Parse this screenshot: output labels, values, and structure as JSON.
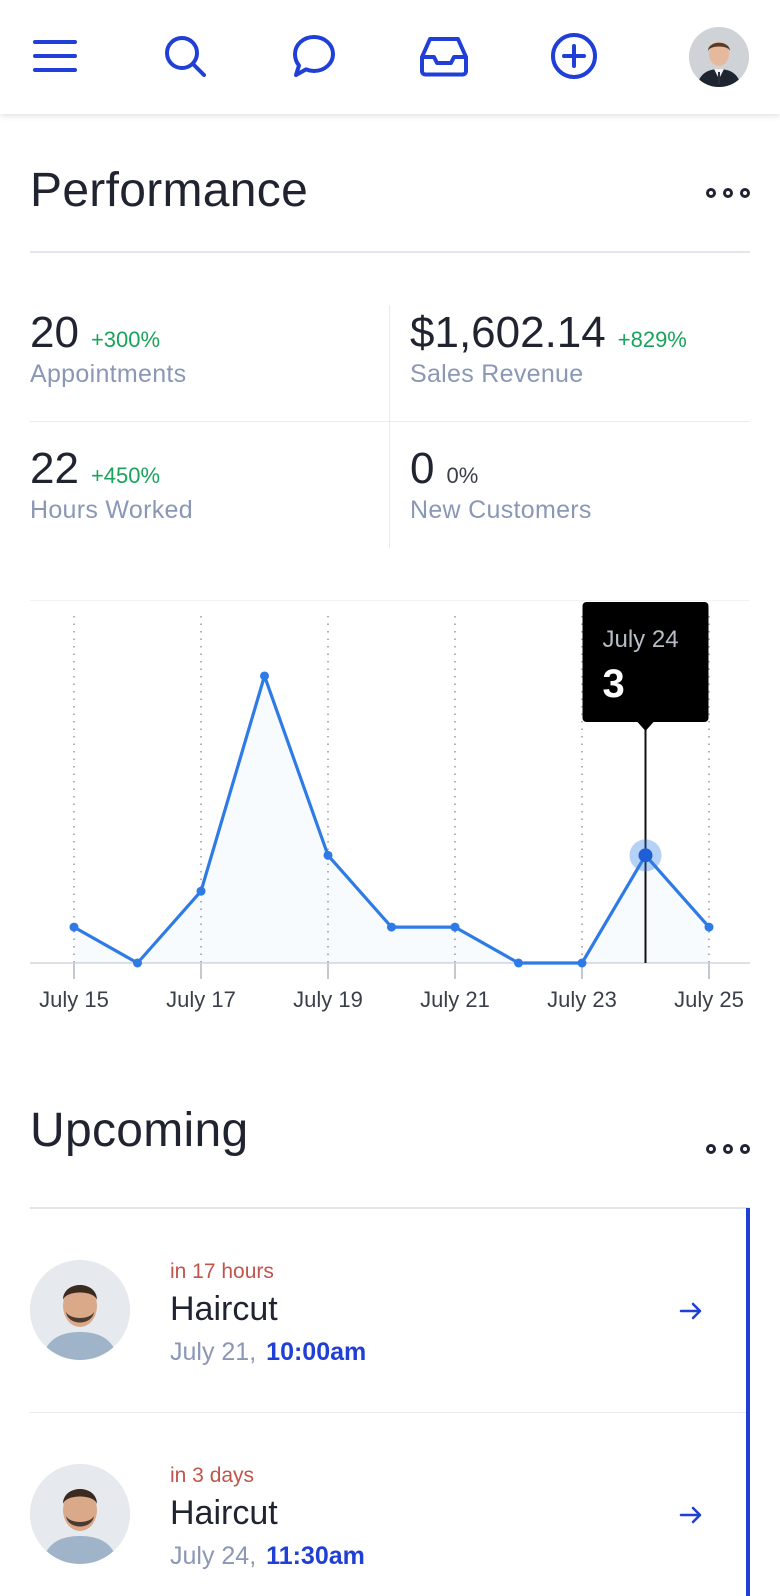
{
  "header": {
    "icons": [
      "menu-icon",
      "search-icon",
      "chat-icon",
      "inbox-icon",
      "add-circle-icon"
    ],
    "accent_color": "#1f3fd6"
  },
  "performance": {
    "title": "Performance",
    "stats": [
      {
        "value": "20",
        "change": "+300%",
        "label": "Appointments"
      },
      {
        "value": "$1,602.14",
        "change": "+829%",
        "label": "Sales Revenue"
      },
      {
        "value": "22",
        "change": "+450%",
        "label": "Hours Worked"
      },
      {
        "value": "0",
        "change": "0%",
        "label": "New Customers"
      }
    ],
    "positive_color": "#1aa35a"
  },
  "chart_data": {
    "type": "line",
    "x": [
      "July 15",
      "July 16",
      "July 17",
      "July 18",
      "July 19",
      "July 20",
      "July 21",
      "July 22",
      "July 23",
      "July 24",
      "July 25"
    ],
    "tick_labels": [
      "July 15",
      "July 17",
      "July 19",
      "July 21",
      "July 23",
      "July 25"
    ],
    "series": [
      {
        "values": [
          1,
          0,
          2,
          8,
          3,
          1,
          1,
          0,
          0,
          3,
          1
        ]
      }
    ],
    "ylim": [
      0,
      8.5
    ],
    "grid": "vertical dotted",
    "line_color": "#2f7be6",
    "tooltip": {
      "date": "July 24",
      "value": "3"
    }
  },
  "upcoming": {
    "title": "Upcoming",
    "appointments": [
      {
        "relative": "in 17 hours",
        "service": "Haircut",
        "date": "July 21,",
        "time": "10:00am"
      },
      {
        "relative": "in 3 days",
        "service": "Haircut",
        "date": "July 24,",
        "time": "11:30am"
      }
    ],
    "relative_color": "#c0554b"
  }
}
